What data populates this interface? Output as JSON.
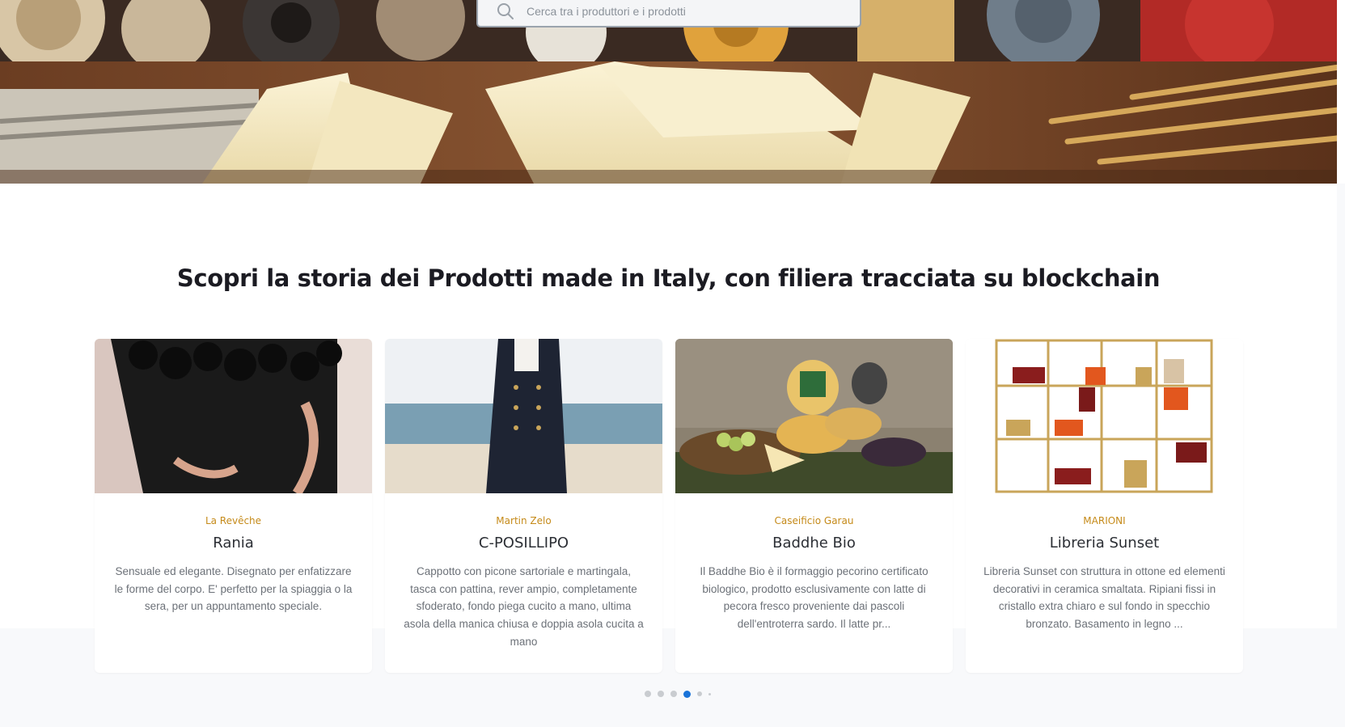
{
  "search": {
    "placeholder": "Cerca tra i produttori e i prodotti"
  },
  "section": {
    "title": "Scopri la storia dei Prodotti made in Italy, con filiera tracciata su blockchain"
  },
  "products": [
    {
      "brand": "La Revêche",
      "name": "Rania",
      "description": "Sensuale ed elegante. Disegnato per enfatizzare le forme del corpo. E' perfetto per la spiaggia o la sera, per un appuntamento speciale."
    },
    {
      "brand": "Martin Zelo",
      "name": "C-POSILLIPO",
      "description": "Cappotto con picone sartoriale e martingala, tasca con pattina, rever ampio, completamente sfoderato, fondo piega cucito a mano, ultima asola della manica chiusa e doppia asola cucita a mano"
    },
    {
      "brand": "Caseificio Garau",
      "name": "Baddhe Bio",
      "description": "Il Baddhe Bio è il formaggio pecorino certificato biologico, prodotto esclusivamente con latte di pecora fresco proveniente dai pascoli dell'entroterra sardo. Il latte pr..."
    },
    {
      "brand": "MARIONI",
      "name": "Libreria Sunset",
      "description": "Libreria Sunset con struttura in ottone ed elementi decorativi in ceramica smaltata. Ripiani fissi in cristallo extra chiaro e sul fondo in specchio bronzato. Basamento in legno ..."
    }
  ],
  "carousel": {
    "active_slide": 4,
    "slide_count": 6
  },
  "colors": {
    "brand_text": "#c58a19",
    "active_dot": "#1a73d9",
    "inactive_dot": "#c9ccd0"
  }
}
